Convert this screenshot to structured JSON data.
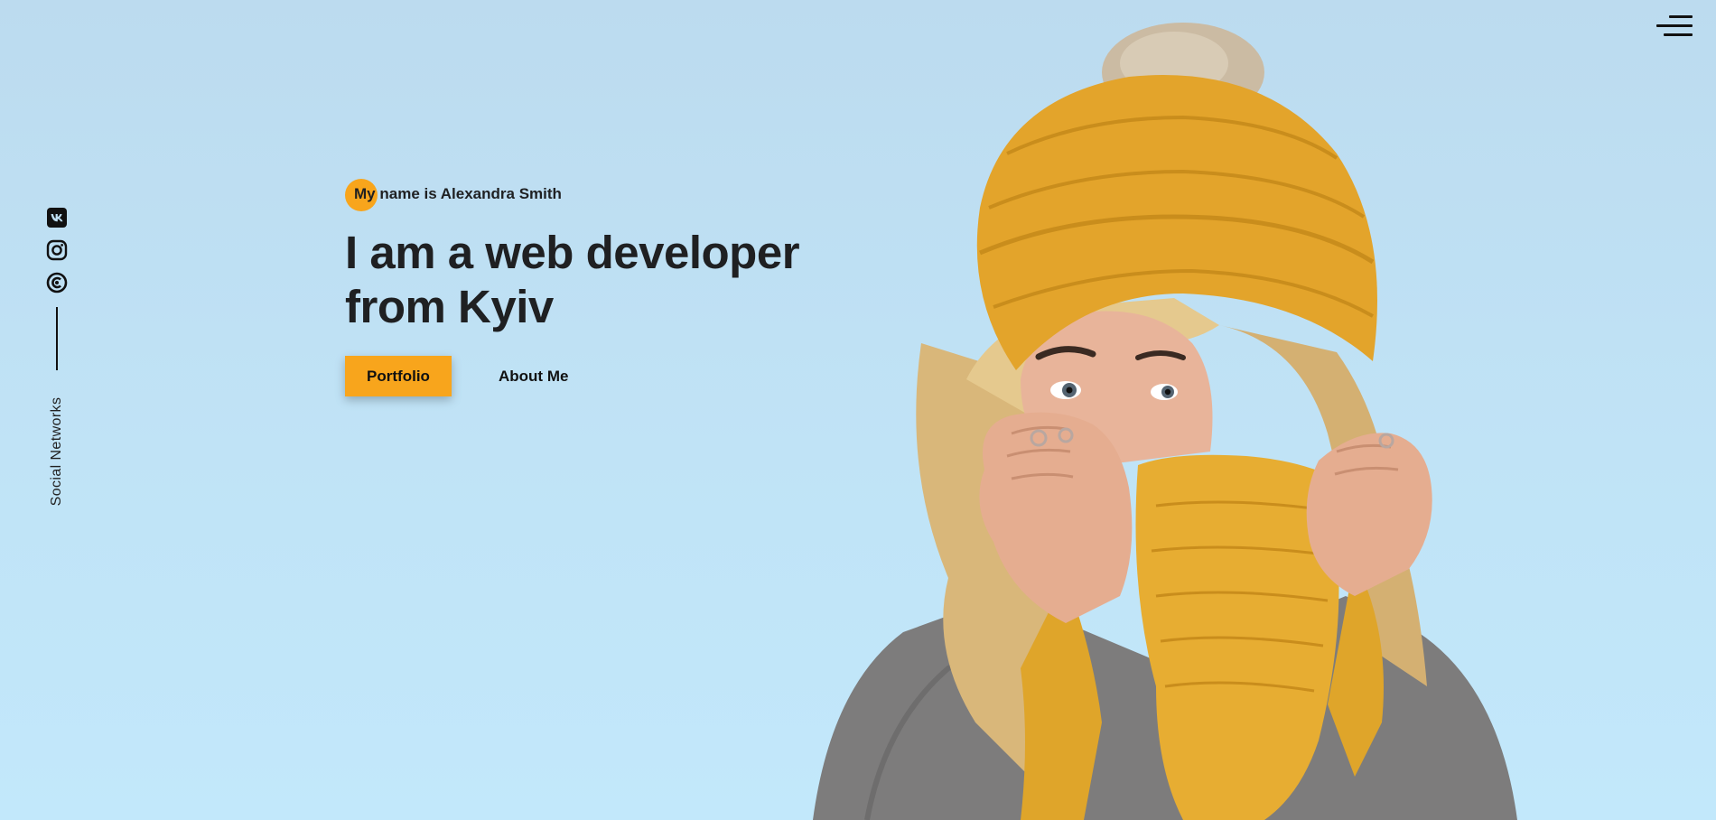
{
  "menu": {
    "icon": "hamburger-menu-icon"
  },
  "social": {
    "label": "Social Networks",
    "items": [
      {
        "name": "vk",
        "icon": "vk-icon"
      },
      {
        "name": "instagram",
        "icon": "instagram-icon"
      },
      {
        "name": "codepen",
        "icon": "codepen-icon"
      }
    ]
  },
  "hero": {
    "intro_highlight": "My",
    "intro_rest": "name is Alexandra Smith",
    "headline_line1": "I am a web developer",
    "headline_line2": "from Kyiv",
    "primary_button": "Portfolio",
    "secondary_button": "About Me"
  },
  "photo": {
    "subject": "woman-in-yellow-knit-hat-and-scarf"
  },
  "colors": {
    "accent": "#f8a51c",
    "background": "#bfe0f4",
    "text": "#1f2022"
  }
}
